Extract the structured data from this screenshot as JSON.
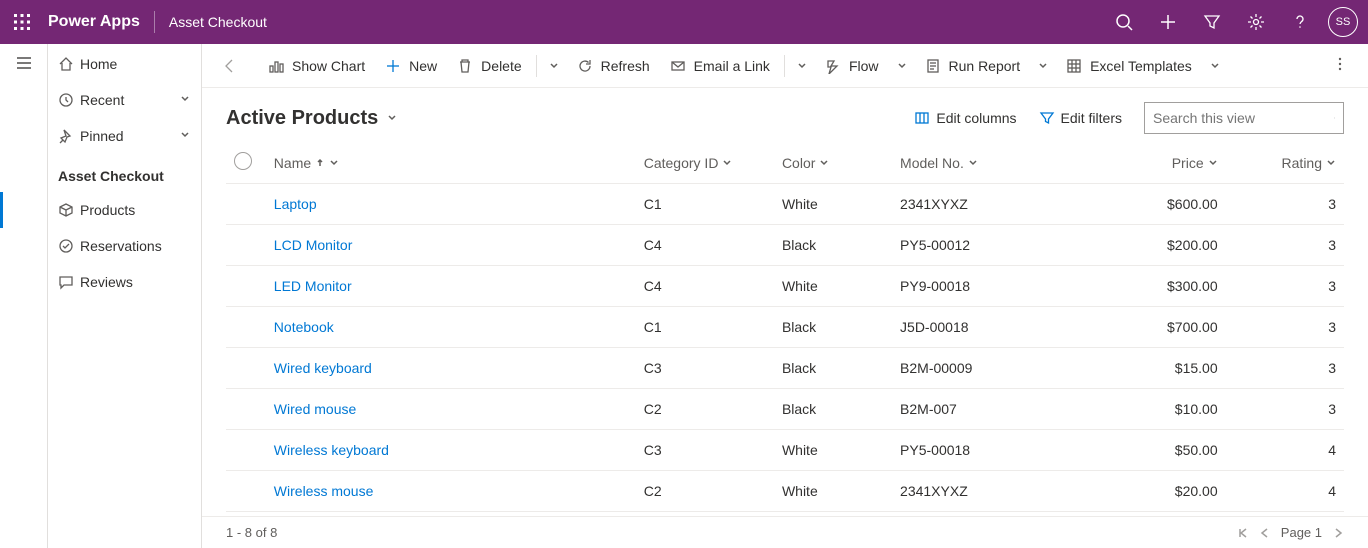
{
  "header": {
    "app_name": "Power Apps",
    "page_name": "Asset Checkout",
    "avatar_initials": "SS"
  },
  "sidebar": {
    "nav": [
      {
        "label": "Home",
        "icon": "home"
      },
      {
        "label": "Recent",
        "icon": "clock",
        "chevron": true
      },
      {
        "label": "Pinned",
        "icon": "pin",
        "chevron": true
      }
    ],
    "section_title": "Asset Checkout",
    "section_items": [
      {
        "label": "Products",
        "icon": "box",
        "active": true
      },
      {
        "label": "Reservations",
        "icon": "check"
      },
      {
        "label": "Reviews",
        "icon": "chat"
      }
    ]
  },
  "commands": {
    "show_chart": "Show Chart",
    "new": "New",
    "delete": "Delete",
    "refresh": "Refresh",
    "email": "Email a Link",
    "flow": "Flow",
    "run_report": "Run Report",
    "excel": "Excel Templates"
  },
  "subhead": {
    "view_title": "Active Products",
    "edit_columns": "Edit columns",
    "edit_filters": "Edit filters",
    "search_placeholder": "Search this view"
  },
  "columns": {
    "name": "Name",
    "category": "Category ID",
    "color": "Color",
    "model": "Model No.",
    "price": "Price",
    "rating": "Rating"
  },
  "rows": [
    {
      "name": "Laptop",
      "category": "C1",
      "color": "White",
      "model": "2341XYXZ",
      "price": "$600.00",
      "rating": "3"
    },
    {
      "name": "LCD Monitor",
      "category": "C4",
      "color": "Black",
      "model": "PY5-00012",
      "price": "$200.00",
      "rating": "3"
    },
    {
      "name": "LED Monitor",
      "category": "C4",
      "color": "White",
      "model": "PY9-00018",
      "price": "$300.00",
      "rating": "3"
    },
    {
      "name": "Notebook",
      "category": "C1",
      "color": "Black",
      "model": "J5D-00018",
      "price": "$700.00",
      "rating": "3"
    },
    {
      "name": "Wired keyboard",
      "category": "C3",
      "color": "Black",
      "model": "B2M-00009",
      "price": "$15.00",
      "rating": "3"
    },
    {
      "name": "Wired mouse",
      "category": "C2",
      "color": "Black",
      "model": "B2M-007",
      "price": "$10.00",
      "rating": "3"
    },
    {
      "name": "Wireless keyboard",
      "category": "C3",
      "color": "White",
      "model": "PY5-00018",
      "price": "$50.00",
      "rating": "4"
    },
    {
      "name": "Wireless mouse",
      "category": "C2",
      "color": "White",
      "model": "2341XYXZ",
      "price": "$20.00",
      "rating": "4"
    }
  ],
  "footer": {
    "range": "1 - 8 of 8",
    "page": "Page 1"
  }
}
